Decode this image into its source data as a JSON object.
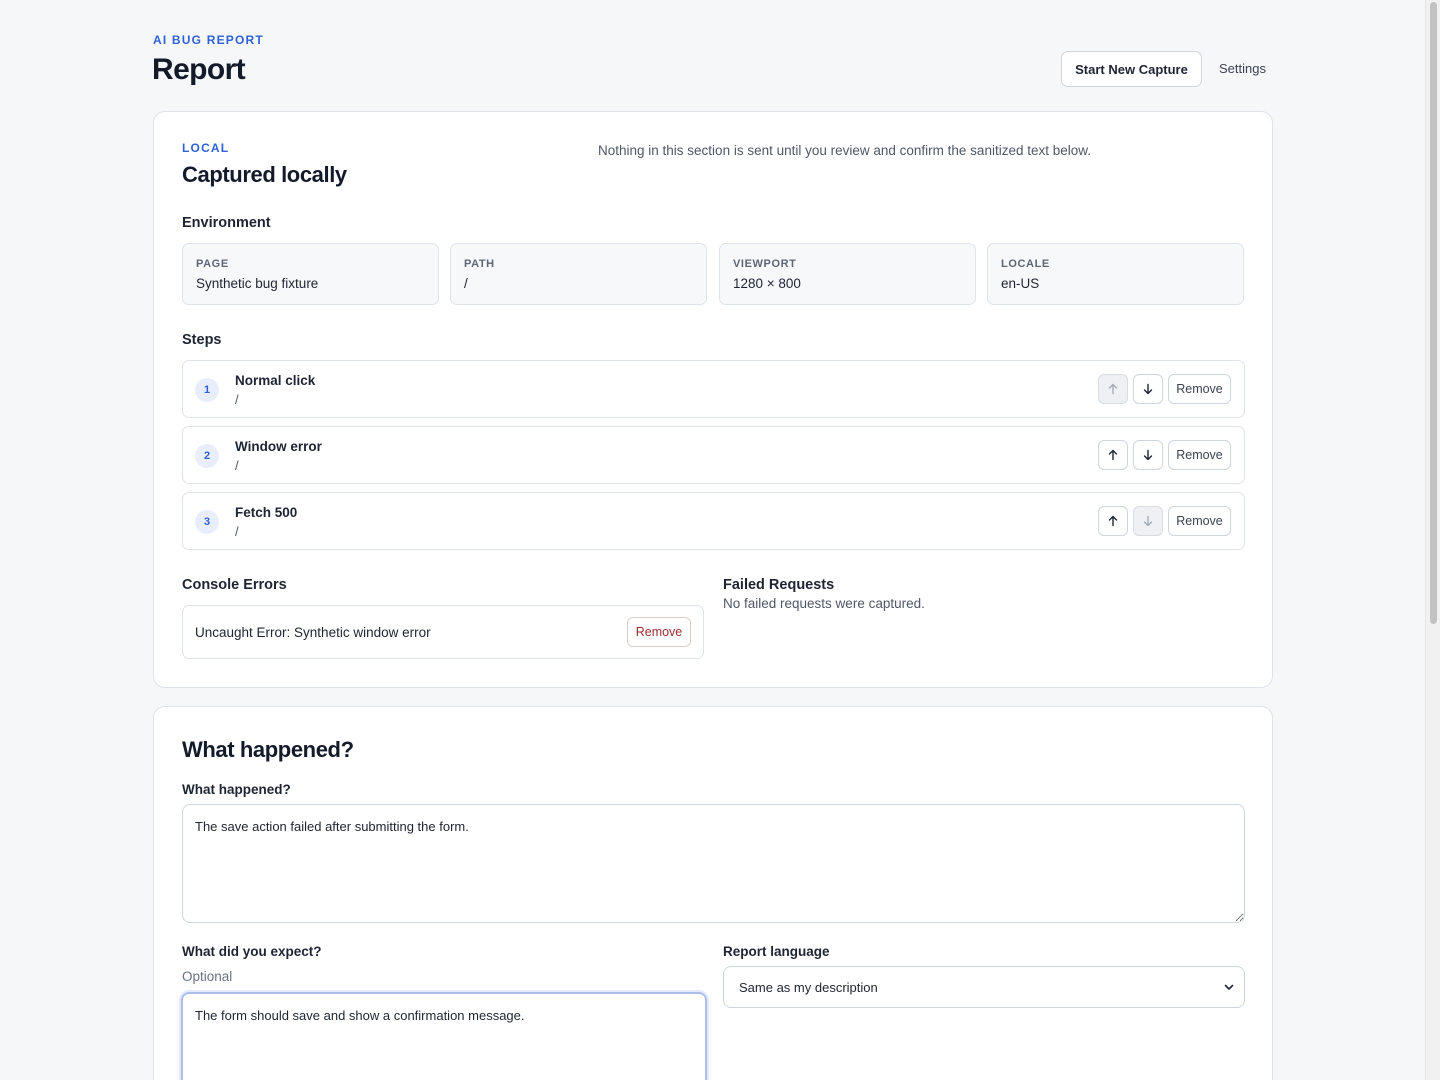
{
  "header": {
    "eyebrow": "AI BUG REPORT",
    "title": "Report",
    "start_capture_label": "Start New Capture",
    "settings_label": "Settings"
  },
  "local": {
    "tag": "LOCAL",
    "title": "Captured locally",
    "notice": "Nothing in this section is sent until you review and confirm the sanitized text below.",
    "environment_heading": "Environment",
    "environment": [
      {
        "label": "PAGE",
        "value": "Synthetic bug fixture"
      },
      {
        "label": "PATH",
        "value": "/"
      },
      {
        "label": "VIEWPORT",
        "value": "1280 × 800"
      },
      {
        "label": "LOCALE",
        "value": "en-US"
      }
    ],
    "steps_heading": "Steps",
    "steps": [
      {
        "num": "1",
        "title": "Normal click",
        "path": "/",
        "remove": "Remove"
      },
      {
        "num": "2",
        "title": "Window error",
        "path": "/",
        "remove": "Remove"
      },
      {
        "num": "3",
        "title": "Fetch 500",
        "path": "/",
        "remove": "Remove"
      }
    ],
    "console_heading": "Console Errors",
    "console_errors": [
      {
        "text": "Uncaught Error: Synthetic window error",
        "remove": "Remove"
      }
    ],
    "failed_heading": "Failed Requests",
    "failed_empty": "No failed requests were captured."
  },
  "what": {
    "title": "What happened?",
    "happened_label": "What happened?",
    "happened_value": "The save action failed after submitting the form.",
    "expect_label": "What did you expect?",
    "expect_hint": "Optional",
    "expect_value": "The form should save and show a confirmation message.",
    "language_label": "Report language",
    "language_value": "Same as my description"
  },
  "icons": {
    "up": "arrow-up-icon",
    "down": "arrow-down-icon",
    "select": "chevron-down-icon"
  },
  "colors": {
    "accent": "#2f62d6",
    "danger": "#9b2c2c",
    "background": "#f6f7f9"
  }
}
